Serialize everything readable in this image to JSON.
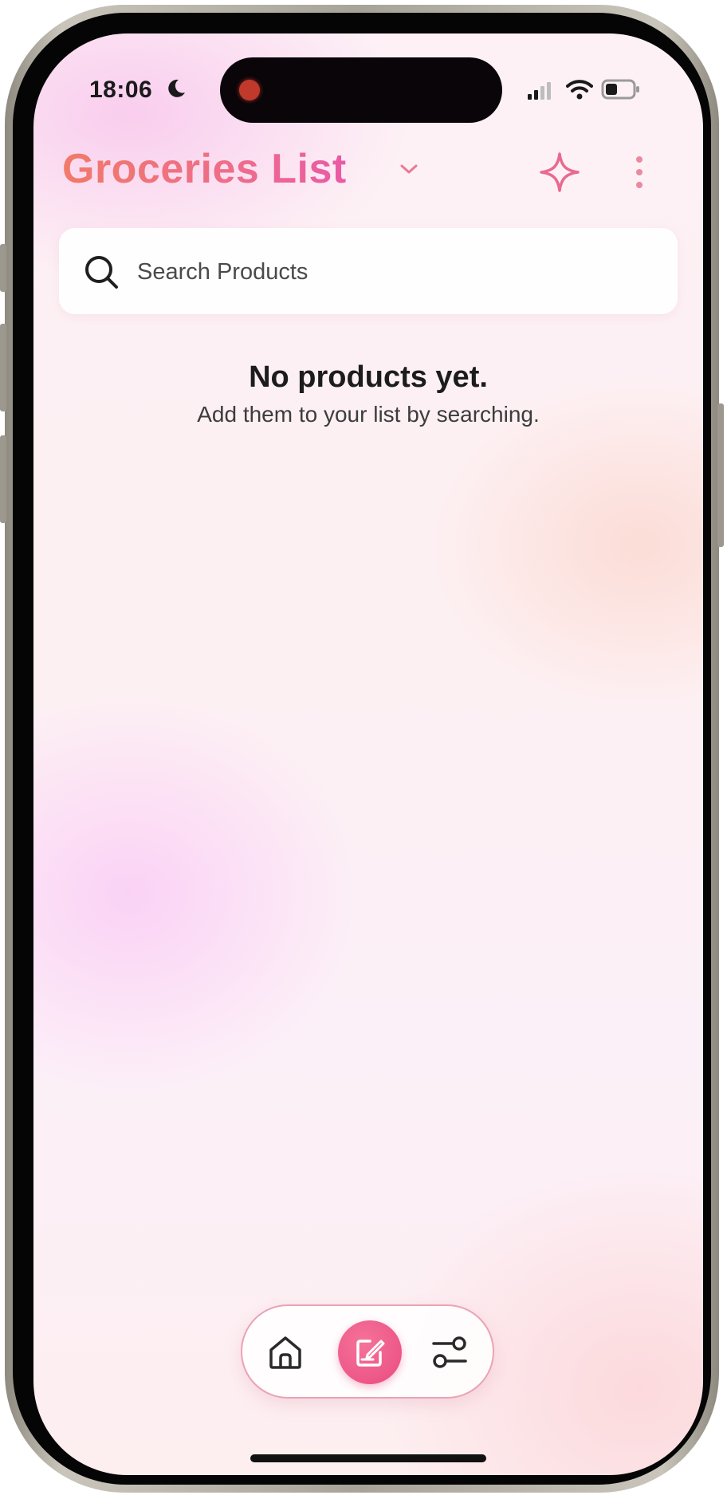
{
  "status_bar": {
    "time": "18:06",
    "focus_icon": "moon-icon",
    "icons": [
      "signal-icon",
      "wifi-icon",
      "battery-icon"
    ]
  },
  "header": {
    "title": "Groceries List",
    "title_chevron_icon": "chevron-down-icon",
    "actions": [
      "sparkle-icon",
      "more-vertical-icon"
    ]
  },
  "search": {
    "placeholder": "Search Products",
    "value": ""
  },
  "empty_state": {
    "title": "No products yet.",
    "subtitle": "Add them to your list by searching."
  },
  "bottom_nav": {
    "items": [
      {
        "icon": "home-icon",
        "active": false
      },
      {
        "icon": "edit-list-icon",
        "active": true
      },
      {
        "icon": "settings-sliders-icon",
        "active": false
      }
    ]
  },
  "colors": {
    "title_gradient_start": "#f07a6a",
    "title_gradient_end": "#e95aa6",
    "accent": "#e94b80",
    "sparkle": "#e96a8f",
    "nav_border": "#eaa3b5"
  }
}
